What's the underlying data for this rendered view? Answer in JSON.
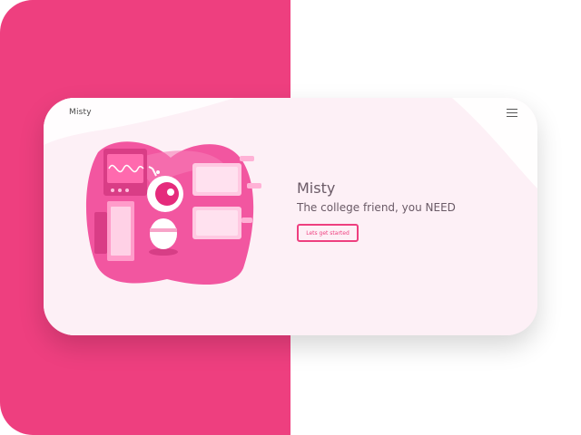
{
  "brand": {
    "name": "Misty"
  },
  "hero": {
    "title": "Misty",
    "subtitle": "The college friend, you NEED",
    "cta_label": "Lets get started"
  },
  "icons": {
    "menu": "hamburger-menu-icon",
    "illustration": "robot-lab-illustration"
  },
  "colors": {
    "accent": "#ee3f7f",
    "card_background": "#fdf0f6",
    "text": "#6a5a66",
    "illustration_primary": "#f256a0"
  }
}
